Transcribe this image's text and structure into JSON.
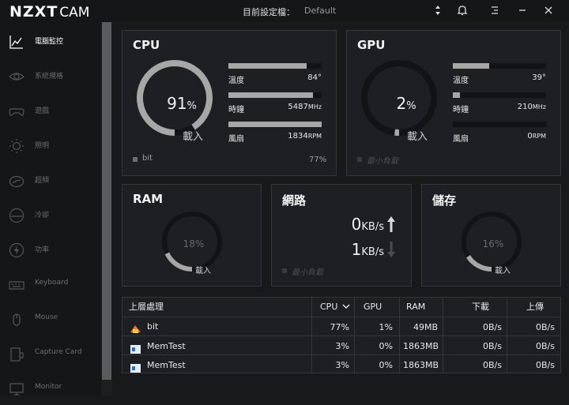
{
  "app": {
    "logo": "NZXT",
    "logo_suffix": "CAM"
  },
  "header": {
    "profile_label": "目前設定檔：",
    "profile_value": "Default"
  },
  "nav": [
    {
      "label": "電腦監控",
      "icon": "line-chart-icon",
      "active": true
    },
    {
      "label": "系統規格",
      "icon": "eye-icon"
    },
    {
      "label": "遊戲",
      "icon": "gamepad-icon"
    },
    {
      "label": "照明",
      "icon": "sun-icon"
    },
    {
      "label": "超頻",
      "icon": "speedometer-icon"
    },
    {
      "label": "冷卻",
      "icon": "fan-gauge-icon"
    },
    {
      "label": "功率",
      "icon": "lightning-icon"
    },
    {
      "label": "Keyboard",
      "icon": "keyboard-icon"
    },
    {
      "label": "Mouse",
      "icon": "mouse-icon"
    },
    {
      "label": "Capture Card",
      "icon": "capture-card-icon"
    },
    {
      "label": "Monitor",
      "icon": "monitor-icon"
    }
  ],
  "cpu": {
    "title": "CPU",
    "load": "91",
    "load_unit": "%",
    "load_label": "載入",
    "load_fraction": 0.91,
    "temp_label": "溫度",
    "temp_value": "84°",
    "temp_fraction": 0.84,
    "clock_label": "時鐘",
    "clock_value": "5487",
    "clock_unit": "MHz",
    "clock_fraction": 0.91,
    "fan_label": "風扇",
    "fan_value": "1834",
    "fan_unit": "RPM",
    "fan_fraction": 1.0,
    "top_process": "bit",
    "top_process_pct": "77%"
  },
  "gpu": {
    "title": "GPU",
    "load": "2",
    "load_unit": "%",
    "load_label": "載入",
    "load_fraction": 0.02,
    "temp_label": "溫度",
    "temp_value": "39°",
    "temp_fraction": 0.39,
    "clock_label": "時鐘",
    "clock_value": "210",
    "clock_unit": "MHz",
    "clock_fraction": 0.08,
    "fan_label": "風扇",
    "fan_value": "0",
    "fan_unit": "RPM",
    "fan_fraction": 0.0,
    "status": "最小負載"
  },
  "ram": {
    "title": "RAM",
    "value": "18%",
    "label": "載入",
    "fraction": 0.18
  },
  "network": {
    "title": "網路",
    "down_value": "0",
    "up_value": "1",
    "unit": "KB/s",
    "status": "最小負載"
  },
  "storage": {
    "title": "儲存",
    "value": "16%",
    "label": "載入",
    "fraction": 0.16
  },
  "processes": {
    "headers": {
      "name": "上層處理",
      "cpu": "CPU",
      "gpu": "GPU",
      "ram": "RAM",
      "down": "下載",
      "up": "上傳"
    },
    "rows": [
      {
        "name": "bit",
        "icon": "bit-app-icon",
        "cpu": "77%",
        "gpu": "1%",
        "ram": "49MB",
        "down": "0B/s",
        "up": "0B/s"
      },
      {
        "name": "MemTest",
        "icon": "memtest-app-icon",
        "cpu": "3%",
        "gpu": "0%",
        "ram": "1863MB",
        "down": "0B/s",
        "up": "0B/s"
      },
      {
        "name": "MemTest",
        "icon": "memtest-app-icon",
        "cpu": "3%",
        "gpu": "0%",
        "ram": "1863MB",
        "down": "0B/s",
        "up": "0B/s"
      }
    ]
  },
  "colors": {
    "accent_gray": "#a7a7a7",
    "ring_dark": "#121315",
    "background": "#18191b",
    "card": "#1e1f22"
  }
}
